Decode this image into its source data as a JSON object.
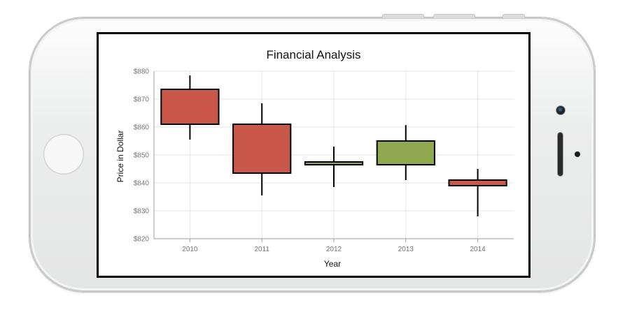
{
  "chart_data": {
    "type": "candlestick",
    "title": "Financial Analysis",
    "xlabel": "Year",
    "ylabel": "Price in Dollar",
    "ylim": [
      820,
      880
    ],
    "yticks": [
      820,
      830,
      840,
      850,
      860,
      870,
      880
    ],
    "ytick_labels": [
      "$820",
      "$830",
      "$840",
      "$850",
      "$860",
      "$870",
      "$880"
    ],
    "categories": [
      "2010",
      "2011",
      "2012",
      "2013",
      "2014"
    ],
    "open": [
      873.5,
      861,
      846.5,
      846.5,
      841
    ],
    "high": [
      878.5,
      868.5,
      853,
      860.7,
      845
    ],
    "low": [
      855.5,
      835.5,
      838.5,
      841,
      828
    ],
    "close": [
      861,
      843.5,
      847.5,
      855,
      839
    ],
    "colors": {
      "up": "#8fa84e",
      "down": "#c9574a",
      "border": "#000000",
      "grid": "#e6e6e6",
      "axis": "#9e9e9e"
    },
    "grid": true
  }
}
